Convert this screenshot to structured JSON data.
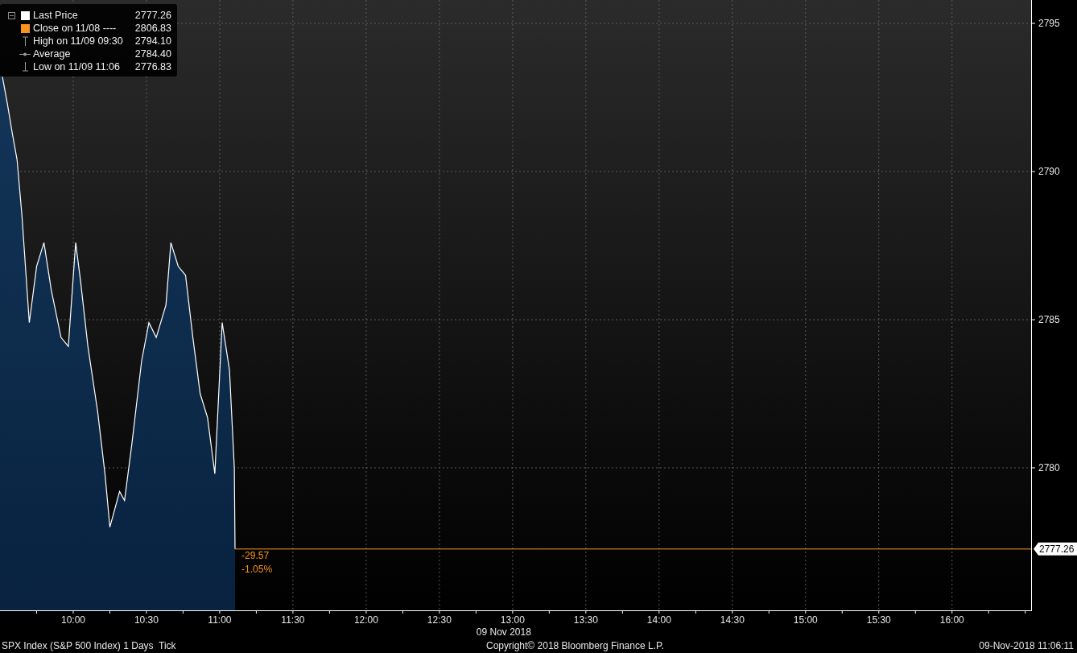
{
  "legend": {
    "items": [
      {
        "kind": "series",
        "color": "#ffffff",
        "value": "2777.26"
      },
      {
        "kind": "square",
        "color": "#f7941d",
        "label": "Close on 11/08 ----",
        "value": "2806.83"
      },
      {
        "kind": "high",
        "label": "High on 11/09 09:30",
        "value": "2794.10"
      },
      {
        "kind": "average",
        "label": "Average",
        "value": "2784.40"
      },
      {
        "kind": "low",
        "label": "Low on 11/09 11:06",
        "value": "2776.83"
      }
    ]
  },
  "chart": {
    "chart_data": {
      "type": "area",
      "x": [
        571,
        573,
        575,
        577,
        579,
        582,
        585,
        588,
        591,
        595,
        598,
        601,
        603,
        606,
        610,
        613,
        615,
        619,
        621,
        624,
        628,
        631,
        634,
        638,
        640,
        643,
        646,
        649,
        652,
        655,
        658,
        661,
        664,
        666,
        666.3
      ],
      "series": [
        {
          "name": "Last Price",
          "color": "#ffffff",
          "values": [
            2793.2,
            2792.3,
            2791.3,
            2790.4,
            2788.5,
            2784.9,
            2786.8,
            2787.6,
            2786.0,
            2784.4,
            2784.1,
            2787.6,
            2786.3,
            2784.1,
            2781.9,
            2779.8,
            2778.0,
            2779.2,
            2778.9,
            2780.8,
            2783.6,
            2784.9,
            2784.4,
            2785.5,
            2787.6,
            2786.8,
            2786.5,
            2784.4,
            2782.5,
            2781.7,
            2779.8,
            2784.9,
            2783.3,
            2780.0,
            2777.26
          ]
        }
      ],
      "xlim": [
        570,
        992.4
      ],
      "ylim": [
        2775.19,
        2795.79
      ],
      "xticks": [
        {
          "value": 600,
          "label": "10:00"
        },
        {
          "value": 630,
          "label": "10:30"
        },
        {
          "value": 660,
          "label": "11:00"
        },
        {
          "value": 690,
          "label": "11:30"
        },
        {
          "value": 720,
          "label": "12:00"
        },
        {
          "value": 750,
          "label": "12:30"
        },
        {
          "value": 780,
          "label": "13:00"
        },
        {
          "value": 810,
          "label": "13:30"
        },
        {
          "value": 840,
          "label": "14:00"
        },
        {
          "value": 870,
          "label": "14:30"
        },
        {
          "value": 900,
          "label": "15:00"
        },
        {
          "value": 930,
          "label": "15:30"
        },
        {
          "value": 960,
          "label": "16:00"
        }
      ],
      "yticks": [
        2780,
        2785,
        2790,
        2795
      ],
      "grid": true
    },
    "last_price_tag": "2777.26",
    "change": "-29.57",
    "change_percent": "-1.05%",
    "date_label": "09 Nov 2018"
  },
  "footer": {
    "security": "SPX Index (S&P 500 Index) 1 Days  Tick",
    "copyright": "Copyright© 2018 Bloomberg Finance L.P.",
    "timestamp": "09-Nov-2018 11:06:11"
  }
}
